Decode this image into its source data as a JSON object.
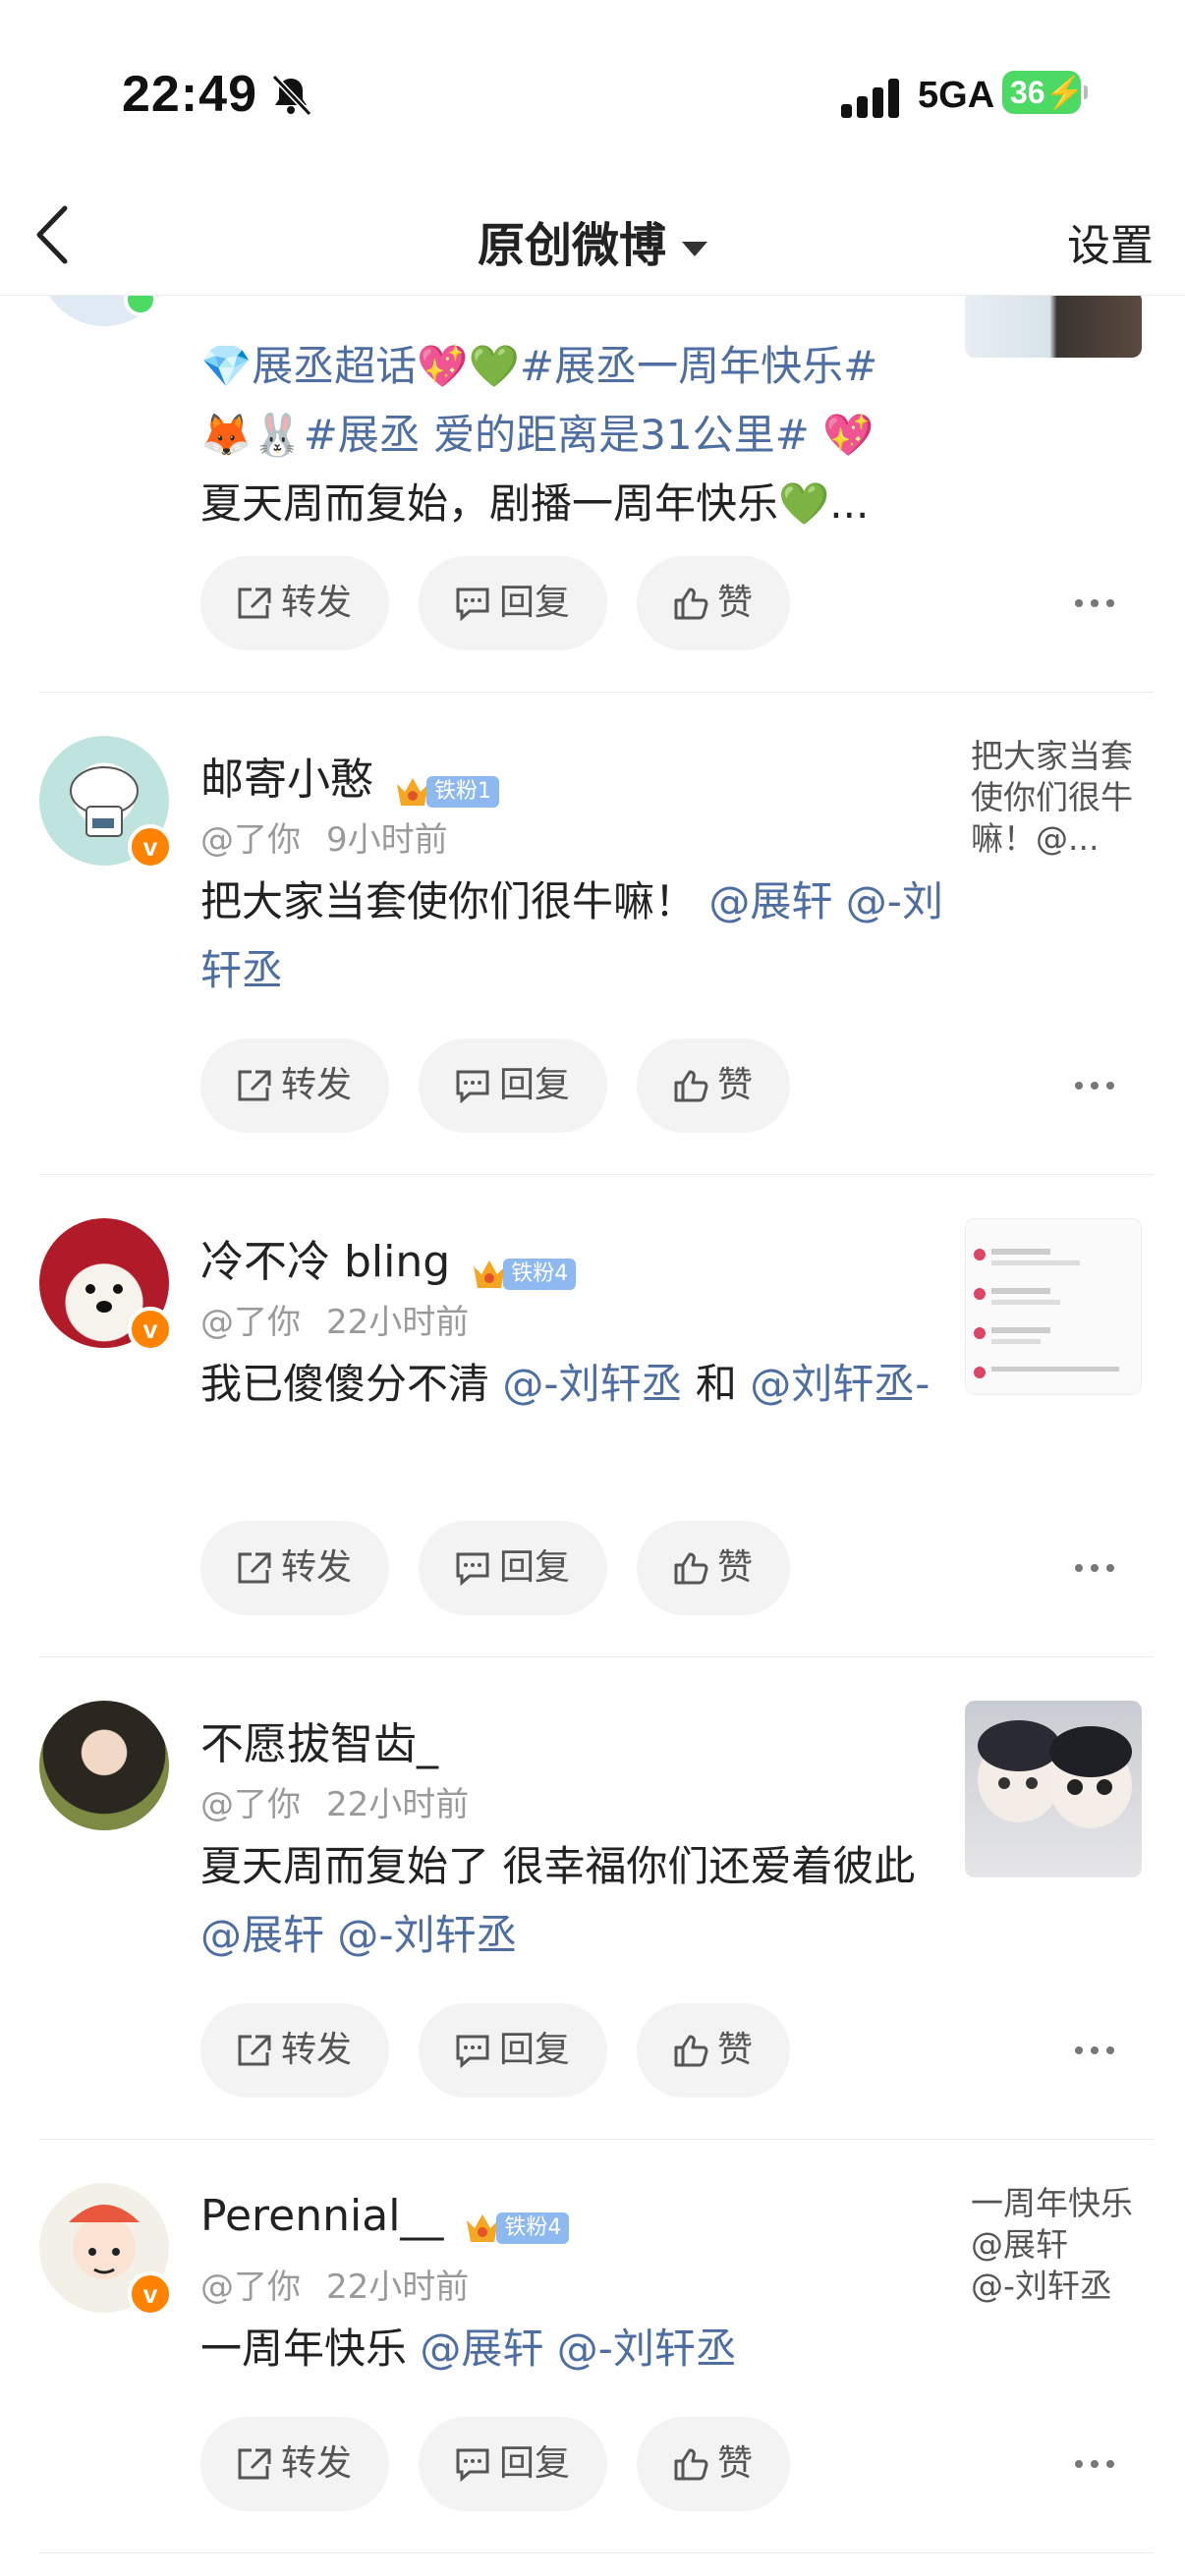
{
  "status": {
    "time": "22:49",
    "network": "5GA",
    "battery": "36"
  },
  "nav": {
    "title": "原创微博",
    "settings": "设置"
  },
  "posts": [
    {
      "text": [
        "💎展丞超话💖💚#展丞一周年快乐#",
        "🦊🐰#展丞 爱的距离是31公里# 💖",
        "夏天周而复始，剧播一周年快乐💚..."
      ],
      "actions": {
        "repost": "转发",
        "reply": "回复",
        "like": "赞"
      }
    },
    {
      "name": "邮寄小憨",
      "fan_level": "铁粉1",
      "meta": "@了你",
      "time": "9小时前",
      "text_main": "把大家当套使你们很牛嘛！",
      "mention1": "@展轩",
      "mention2": "@-刘轩丞",
      "quote": "把大家当套使你们很牛嘛！@...",
      "actions": {
        "repost": "转发",
        "reply": "回复",
        "like": "赞"
      }
    },
    {
      "name": "冷不冷 bling",
      "fan_level": "铁粉4",
      "meta": "@了你",
      "time": "22小时前",
      "text_main": "我已傻傻分不清",
      "mention1": "@-刘轩丞",
      "connector": "和",
      "mention2": "@刘轩丞-",
      "actions": {
        "repost": "转发",
        "reply": "回复",
        "like": "赞"
      }
    },
    {
      "name": "不愿拔智齿_",
      "meta": "@了你",
      "time": "22小时前",
      "text_main": "夏天周而复始了 很幸福你们还爱着彼此",
      "mention1": "@展轩",
      "mention2": "@-刘轩丞",
      "actions": {
        "repost": "转发",
        "reply": "回复",
        "like": "赞"
      }
    },
    {
      "name": "Perennial__",
      "fan_level": "铁粉4",
      "meta": "@了你",
      "time": "22小时前",
      "text_main": "一周年快乐",
      "mention1": "@展轩",
      "mention2": "@-刘轩丞",
      "quote_lines": [
        "一周年快乐",
        "@展轩",
        "@-刘轩丞"
      ],
      "actions": {
        "repost": "转发",
        "reply": "回复",
        "like": "赞"
      }
    }
  ],
  "colors": {
    "link": "#4e6ea2",
    "badge": "#ff8200",
    "fan_tag": "#8db8f0",
    "battery": "#4cd964"
  }
}
